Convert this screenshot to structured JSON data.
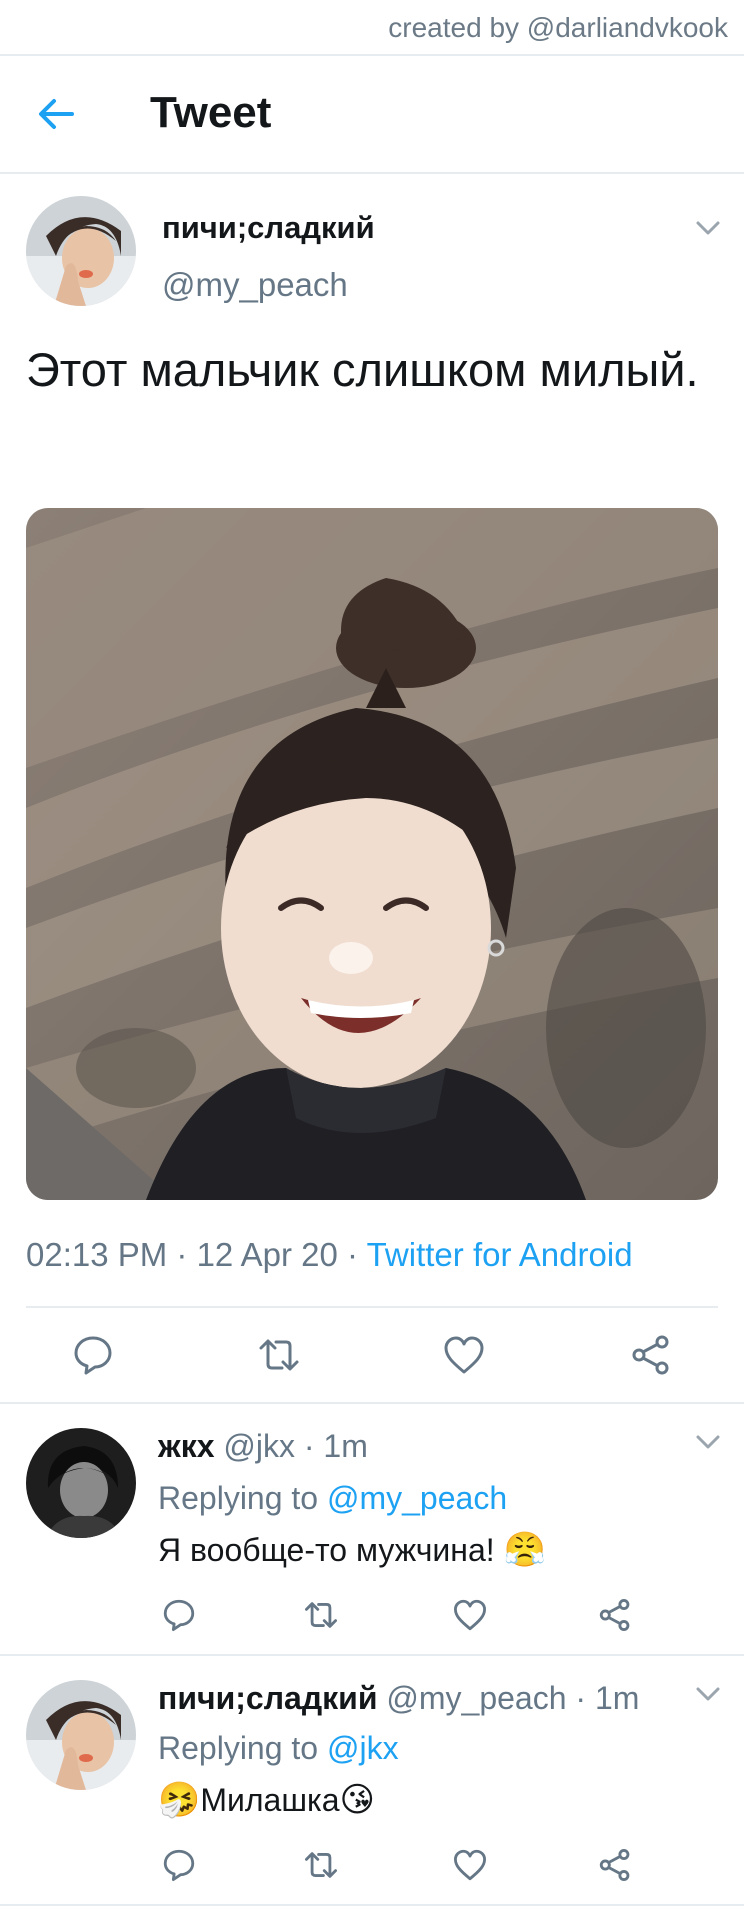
{
  "credit": "created by @darliandvkook",
  "header": {
    "title": "Tweet",
    "back_icon": "arrow-left-icon"
  },
  "colors": {
    "accent": "#1da1f2",
    "secondary_text": "#657786",
    "divider": "#e6ecf0"
  },
  "tweet": {
    "name": "пичи;сладкий",
    "handle": "@my_peach",
    "text": "Этот мальчик слишком милый.",
    "time": "02:13 PM",
    "date": "12 Apr 20",
    "separator": " · ",
    "source": "Twitter for Android",
    "actions": [
      "reply-icon",
      "retweet-icon",
      "like-icon",
      "share-icon"
    ]
  },
  "replies": [
    {
      "name": "жкх",
      "handle": "@jkx",
      "time": "· 1m",
      "replying_prefix": "Replying to",
      "replying_to": "@my_peach",
      "text": "Я вообще-то мужчина! ",
      "emoji_after": "😤",
      "emoji_before": ""
    },
    {
      "name": "пичи;сладкий",
      "handle": "@my_peach",
      "time": "· 1m",
      "replying_prefix": "Replying to",
      "replying_to": "@jkx",
      "text": "Милашка",
      "emoji_before": "🤧",
      "emoji_after": "😘"
    }
  ]
}
